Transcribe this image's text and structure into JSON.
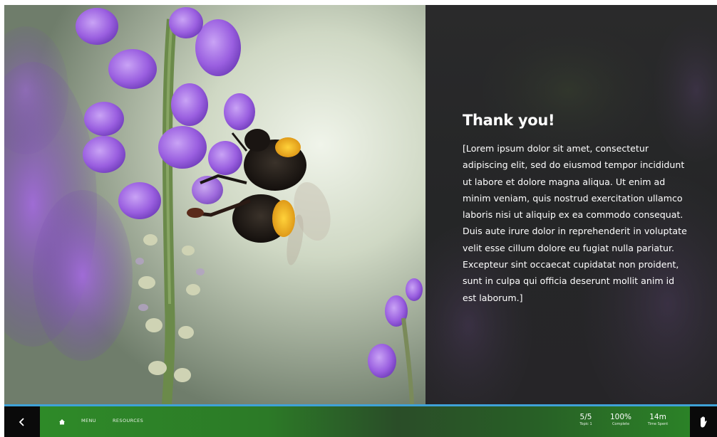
{
  "slide": {
    "title": "Thank you!",
    "body": "[Lorem ipsum dolor sit amet, consectetur adipiscing elit, sed do eiusmod tempor incididunt ut labore et dolore magna aliqua. Ut enim ad minim veniam, quis nostrud exercitation ullamco laboris nisi ut aliquip ex ea commodo consequat. Duis aute irure dolor in reprehenderit in voluptate velit esse cillum dolore eu fugiat nulla pariatur. Excepteur sint occaecat cupidatat non proident, sunt in culpa qui officia deserunt mollit anim id est laborum.]"
  },
  "footer": {
    "prev_icon": "chevron-left-icon",
    "home_icon": "home-icon",
    "menu_label": "MENU",
    "resources_label": "RESOURCES",
    "progress": {
      "value": "5/5",
      "label": "Topic 1"
    },
    "completion": {
      "value": "100%",
      "label": "Complete"
    },
    "time": {
      "value": "14m",
      "label": "Time Spent"
    },
    "next_icon": "hand-icon"
  },
  "colors": {
    "accent_line": "#3fa2d8",
    "bar_green": "#2e8a28",
    "nav_button": "#0a0a0a",
    "panel": "#262627"
  }
}
